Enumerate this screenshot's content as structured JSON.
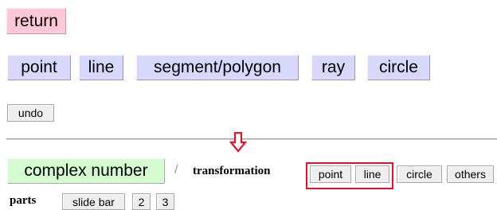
{
  "top": {
    "return_label": "return"
  },
  "draw_tools": [
    "point",
    "line",
    "segment/polygon",
    "ray",
    "circle"
  ],
  "edit": {
    "undo_label": "undo"
  },
  "modes": {
    "complex_label": "complex number",
    "separator": "/",
    "transformation_label": "transformation",
    "transformation_tools": [
      "point",
      "line",
      "circle",
      "others"
    ]
  },
  "parts": {
    "label": "parts",
    "buttons": [
      "slide bar",
      "2",
      "3"
    ]
  },
  "colors": {
    "return_bg": "#ffc8d8",
    "tool_bg": "#d8d8fc",
    "complex_bg": "#d4fcd0",
    "highlight": "#e8102a",
    "arrow": "#e8102a"
  }
}
